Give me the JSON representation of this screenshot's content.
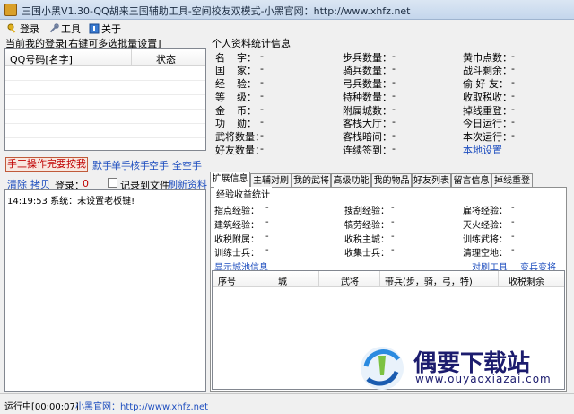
{
  "window": {
    "title": "三国小黑V1.30-QQ胡来三国辅助工具-空间校友双模式-小黑官网：http://www.xhfz.net"
  },
  "menu": {
    "login": "登录",
    "tools": "工具",
    "about": "关于"
  },
  "accounts": {
    "label": "当前我的登录[右键可多选批量设置]",
    "col_qq": "QQ号码[名字]",
    "col_status": "状态"
  },
  "actions": {
    "manual": "手工操作完要按我",
    "links": [
      "默手",
      "单手",
      "核手",
      "空手",
      "全空手"
    ]
  },
  "options": {
    "clear": "清除",
    "copy": "拷贝",
    "login_label": "登录：",
    "login_count": "0",
    "record_to_file": "记录到文件",
    "refresh": "刷新资料"
  },
  "log": {
    "line1": "14:19:53 系统：未设置老板键!"
  },
  "stats": {
    "title": "个人资料统计信息",
    "col1": [
      [
        "名",
        "字：",
        "-"
      ],
      [
        "国",
        "家：",
        "-"
      ],
      [
        "经",
        "验：",
        "-"
      ],
      [
        "等",
        "级：",
        "-"
      ],
      [
        "金",
        "币：",
        "-"
      ],
      [
        "功",
        "勋：",
        "-"
      ],
      [
        "武将数量：",
        "",
        "-"
      ],
      [
        "好友数量：",
        "",
        "-"
      ]
    ],
    "col2": [
      [
        "步兵数量：",
        "-"
      ],
      [
        "骑兵数量：",
        "-"
      ],
      [
        "弓兵数量：",
        "-"
      ],
      [
        "特种数量：",
        "-"
      ],
      [
        "附属城数：",
        "-"
      ],
      [
        "客栈大厅：",
        "-"
      ],
      [
        "客栈暗间：",
        "-"
      ],
      [
        "连续签到：",
        "-"
      ]
    ],
    "col3": [
      [
        "黄巾点数：",
        "-"
      ],
      [
        "战斗剩余：",
        "-"
      ],
      [
        "偷 好 友：",
        "-"
      ],
      [
        "收取税收：",
        "-"
      ],
      [
        "掉线重登：",
        "-"
      ],
      [
        "今日运行：",
        "-"
      ],
      [
        "本次运行：",
        "-"
      ]
    ],
    "local_settings": "本地设置"
  },
  "tabs": [
    "扩展信息",
    "主辅对刷",
    "我的武将",
    "高级功能",
    "我的物品",
    "好友列表",
    "留言信息",
    "掉线重登"
  ],
  "expansion": {
    "group_title": "经验收益统计",
    "rows": [
      [
        [
          "指点经验：",
          "-"
        ],
        [
          "搜刮经验：",
          "-"
        ],
        [
          "雇将经验：",
          "-"
        ]
      ],
      [
        [
          "建筑经验：",
          "-"
        ],
        [
          "犒劳经验：",
          "-"
        ],
        [
          "灭火经验：",
          "-"
        ]
      ],
      [
        [
          "收税附属：",
          "-"
        ],
        [
          "收税主城：",
          "-"
        ],
        [
          "训练武将：",
          "-"
        ]
      ],
      [
        [
          "训练士兵：",
          "-"
        ],
        [
          "收集士兵：",
          "-"
        ],
        [
          "清理空地：",
          "-"
        ]
      ]
    ],
    "show_city": "显示城池信息",
    "brush_tool": "对刷工具",
    "change_general": "变兵变将"
  },
  "table": {
    "columns": [
      "序号",
      "城",
      "武将",
      "带兵(步，骑，弓，特)",
      "收税剩余"
    ]
  },
  "status": {
    "running": "运行中[00:00:07]",
    "site": "小黑官网：http://www.xhfz.net"
  },
  "watermark": {
    "text": "偶要下载站",
    "sub": "www.ouyaoxiazai.com"
  }
}
